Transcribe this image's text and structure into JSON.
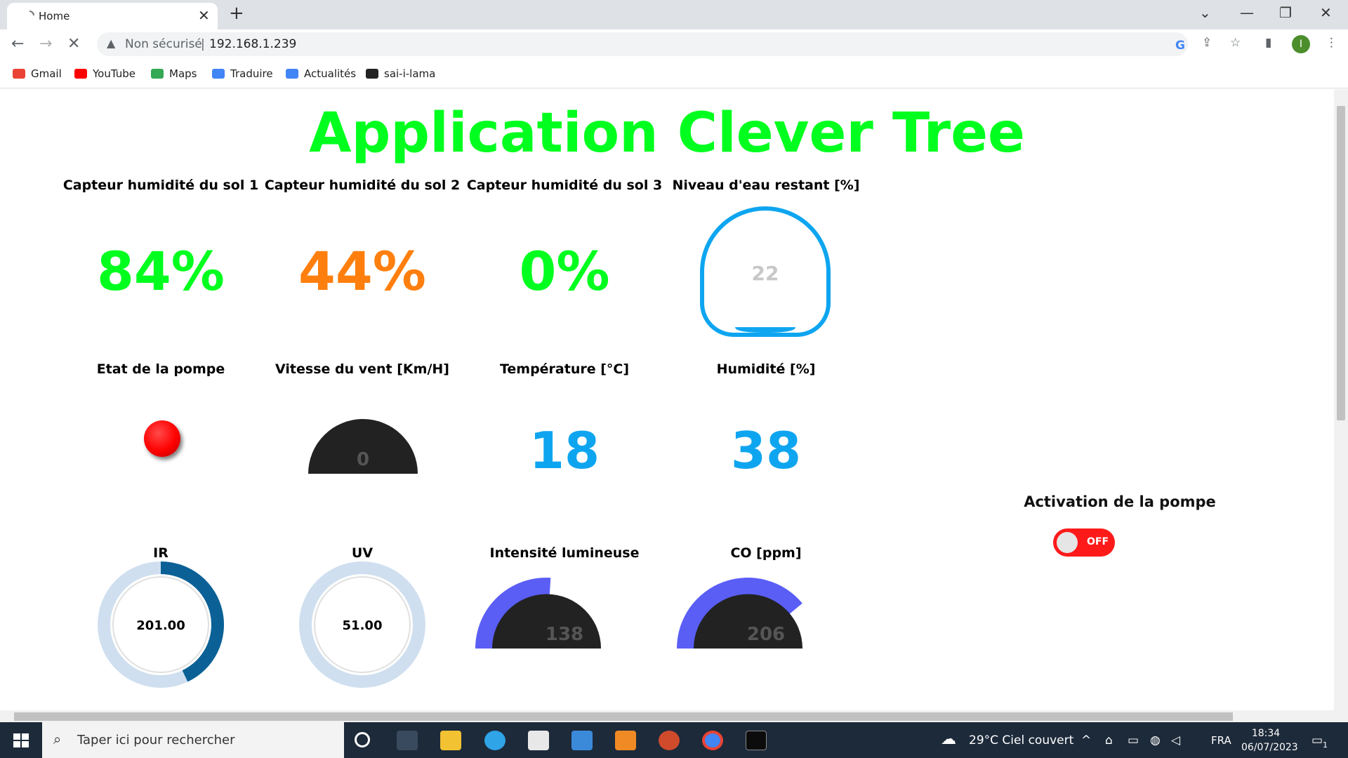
{
  "browser": {
    "tab_title": "Home",
    "security_label": "Non sécurisé",
    "url": "192.168.1.239",
    "profile_initial": "I"
  },
  "bookmarks": [
    {
      "label": "Gmail",
      "color": "#ea4335"
    },
    {
      "label": "YouTube",
      "color": "#ff0000"
    },
    {
      "label": "Maps",
      "color": "#34a853"
    },
    {
      "label": "Traduire",
      "color": "#4285f4"
    },
    {
      "label": "Actualités",
      "color": "#4285f4"
    },
    {
      "label": "sai-i-lama",
      "color": "#222222"
    }
  ],
  "app": {
    "title": "Application Clever Tree",
    "colors": {
      "title": "#00ff1e",
      "green": "#00ff1e",
      "orange": "#ff7f0e",
      "blue": "#0ea5f0",
      "dark": "#222222",
      "violet": "#5a5ef5",
      "ring": "#cfdfef",
      "ring_fill": "#0b6196"
    },
    "soil1": {
      "label": "Capteur humidité du sol 1",
      "value": "84%"
    },
    "soil2": {
      "label": "Capteur humidité du sol 2",
      "value": "44%"
    },
    "soil3": {
      "label": "Capteur humidité du sol 3",
      "value": "0%"
    },
    "water": {
      "label": "Niveau d'eau restant [%]",
      "value": "22",
      "level": 22
    },
    "pump_state": {
      "label": "Etat de la pompe",
      "state": "off",
      "color": "#ff0000"
    },
    "wind": {
      "label": "Vitesse du vent [Km/H]",
      "value": "0"
    },
    "temperature": {
      "label": "Température [°C]",
      "value": "18"
    },
    "humidity": {
      "label": "Humidité [%]",
      "value": "38"
    },
    "ir": {
      "label": "IR",
      "value": "201.00",
      "fraction": 0.43
    },
    "uv": {
      "label": "UV",
      "value": "51.00",
      "fraction": 0.0
    },
    "light": {
      "label": "Intensité lumineuse",
      "value": "138",
      "fraction": 0.52
    },
    "co": {
      "label": "CO [ppm]",
      "value": "206",
      "fraction": 0.78
    },
    "pump_activation": {
      "label": "Activation de la pompe",
      "switch_label": "OFF",
      "on": false
    }
  },
  "taskbar": {
    "search_placeholder": "Taper ici pour rechercher",
    "weather": "29°C  Ciel couvert",
    "language": "FRA",
    "time": "18:34",
    "date": "06/07/2023",
    "notifications": "1"
  }
}
